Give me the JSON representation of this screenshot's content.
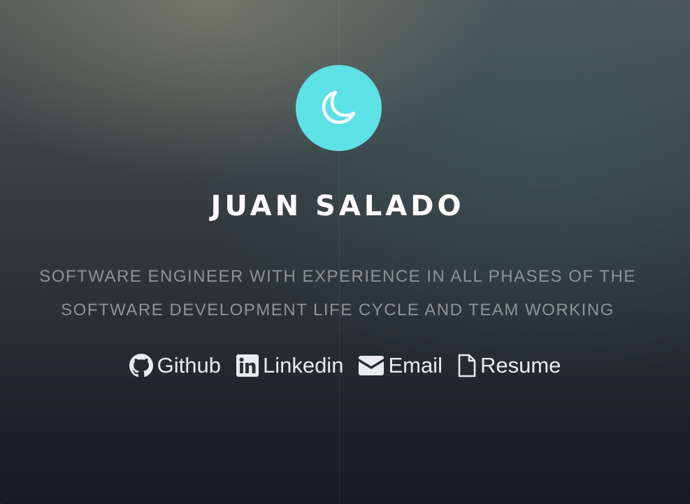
{
  "hero": {
    "name": "JUAN SALADO",
    "tagline_line1": "SOFTWARE ENGINEER WITH EXPERIENCE IN ALL PHASES OF THE",
    "tagline_line2": "SOFTWARE DEVELOPMENT LIFE CYCLE AND TEAM WORKING",
    "logo_icon": "moon-icon",
    "accent_color": "#5ce1e6"
  },
  "links": [
    {
      "label": "Github",
      "icon": "github-icon"
    },
    {
      "label": "Linkedin",
      "icon": "linkedin-icon"
    },
    {
      "label": "Email",
      "icon": "envelope-icon"
    },
    {
      "label": "Resume",
      "icon": "file-icon"
    }
  ]
}
